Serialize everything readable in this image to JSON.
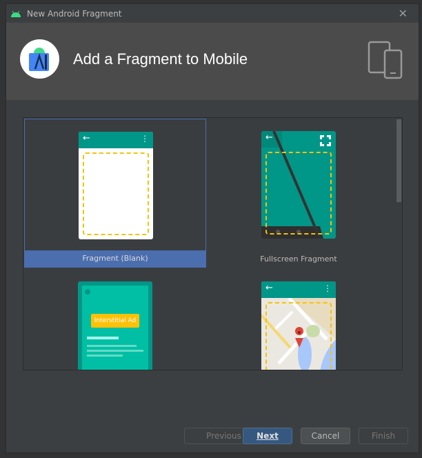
{
  "window": {
    "title": "New Android Fragment",
    "close_icon": "close-icon"
  },
  "header": {
    "title": "Add a Fragment to Mobile",
    "logo": "android-studio-logo",
    "device_icon": "tablet-phone-icon"
  },
  "templates": [
    {
      "label": "Fragment (Blank)",
      "selected": true
    },
    {
      "label": "Fullscreen Fragment",
      "selected": false
    },
    {
      "label": "",
      "badge": "Interstitial Ad",
      "selected": false
    },
    {
      "label": "",
      "selected": false
    }
  ],
  "buttons": {
    "previous": "Previous",
    "next": "Next",
    "cancel": "Cancel",
    "finish": "Finish"
  },
  "colors": {
    "accent": "#4b6eaf",
    "teal": "#009688",
    "dash": "#f4c20d"
  }
}
